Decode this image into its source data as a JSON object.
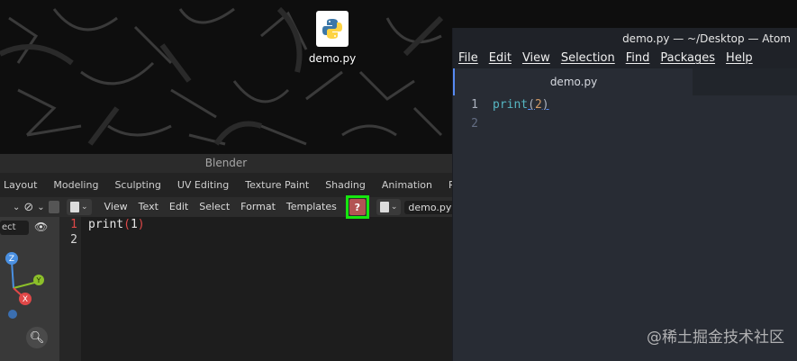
{
  "desktop": {
    "icon": {
      "label": "demo.py",
      "icon": "python-file-icon"
    }
  },
  "blender": {
    "title": "Blender",
    "workspace_tabs": [
      "Layout",
      "Modeling",
      "Sculpting",
      "UV Editing",
      "Texture Paint",
      "Shading",
      "Animation",
      "Rendering"
    ],
    "viewport": {
      "mode_label": "ect"
    },
    "text_editor": {
      "menus": [
        "View",
        "Text",
        "Edit",
        "Select",
        "Format",
        "Templates"
      ],
      "filename": "demo.py",
      "line_numbers": [
        "1",
        "2"
      ],
      "code": {
        "keyword": "print",
        "open": "(",
        "arg": "1",
        "close": ")"
      }
    }
  },
  "atom": {
    "title": "demo.py — ~/Desktop — Atom",
    "menus": [
      "File",
      "Edit",
      "View",
      "Selection",
      "Find",
      "Packages",
      "Help"
    ],
    "tab": "demo.py",
    "line_numbers": [
      "1",
      "2"
    ],
    "code": {
      "keyword": "print",
      "open": "(",
      "arg": "2",
      "close": ")"
    }
  },
  "watermark": "@稀土掘金技术社区",
  "colors": {
    "highlight": "#16e60f",
    "blender_help": "#b35454",
    "atom_accent": "#568af2"
  }
}
